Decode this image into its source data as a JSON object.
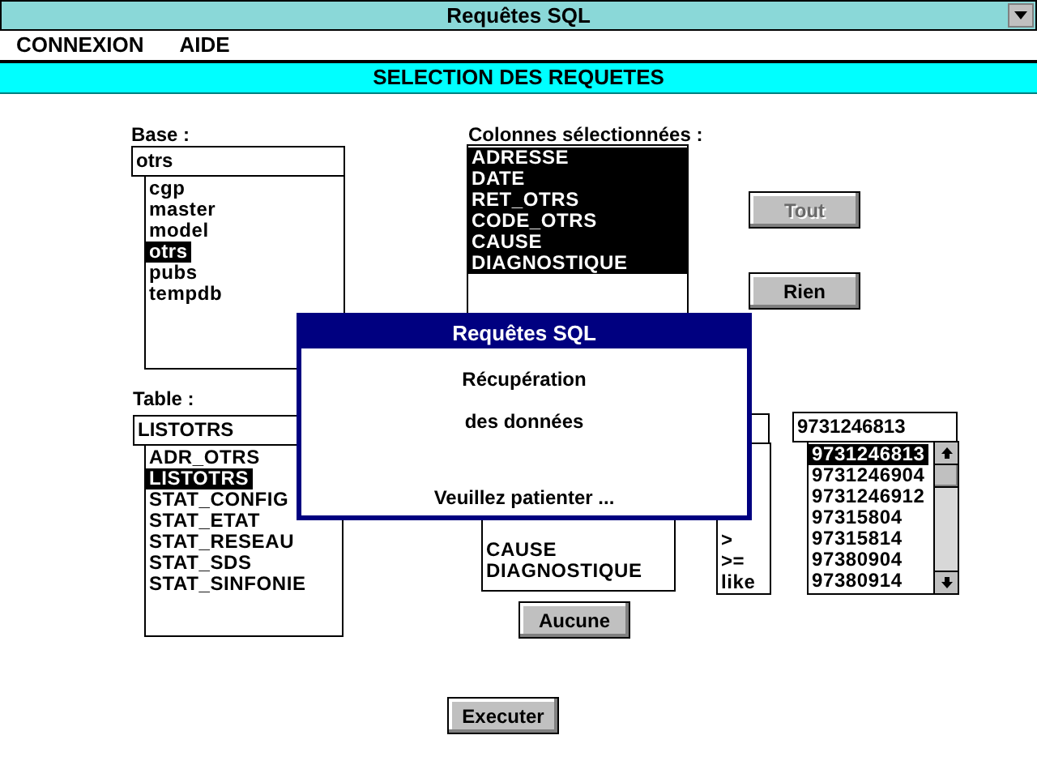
{
  "window": {
    "title": "Requêtes SQL"
  },
  "menu": [
    {
      "label": "CONNEXION"
    },
    {
      "label": "AIDE"
    }
  ],
  "header": "SELECTION DES REQUETES",
  "base": {
    "label": "Base :",
    "value": "otrs",
    "items": [
      {
        "label": "cgp",
        "selected": false
      },
      {
        "label": "master",
        "selected": false
      },
      {
        "label": "model",
        "selected": false
      },
      {
        "label": "otrs",
        "selected": true
      },
      {
        "label": "pubs",
        "selected": false
      },
      {
        "label": "tempdb",
        "selected": false
      }
    ]
  },
  "columns": {
    "label": "Colonnes sélectionnées :",
    "items": [
      {
        "label": "ADRESSE",
        "selected": true
      },
      {
        "label": "DATE",
        "selected": true
      },
      {
        "label": "RET_OTRS",
        "selected": true
      },
      {
        "label": "CODE_OTRS",
        "selected": true
      },
      {
        "label": "CAUSE",
        "selected": true
      },
      {
        "label": "DIAGNOSTIQUE",
        "selected": true
      }
    ]
  },
  "column_buttons": [
    {
      "label": "Tout",
      "disabled": true
    },
    {
      "label": "Rien",
      "disabled": false
    }
  ],
  "table": {
    "label": "Table :",
    "value": "LISTOTRS",
    "items": [
      {
        "label": "ADR_OTRS",
        "selected": false
      },
      {
        "label": "LISTOTRS",
        "selected": true
      },
      {
        "label": "STAT_CONFIG",
        "selected": false
      },
      {
        "label": "STAT_ETAT",
        "selected": false
      },
      {
        "label": "STAT_RESEAU",
        "selected": false
      },
      {
        "label": "STAT_SDS",
        "selected": false
      },
      {
        "label": "STAT_SINFONIE",
        "selected": false
      }
    ]
  },
  "field_list": {
    "items": [
      {
        "label": "CAUSE",
        "selected": false
      },
      {
        "label": "DIAGNOSTIQUE",
        "selected": false
      }
    ],
    "button": {
      "label": "Aucune",
      "disabled": false
    }
  },
  "operators": {
    "items": [
      {
        "label": ">",
        "selected": false
      },
      {
        "label": ">=",
        "selected": false
      },
      {
        "label": "like",
        "selected": false
      }
    ]
  },
  "values": {
    "value": "9731246813",
    "items": [
      {
        "label": "9731246813",
        "selected": true
      },
      {
        "label": "9731246904",
        "selected": false
      },
      {
        "label": "9731246912",
        "selected": false
      },
      {
        "label": "97315804",
        "selected": false
      },
      {
        "label": "97315814",
        "selected": false
      },
      {
        "label": "97380904",
        "selected": false
      },
      {
        "label": "97380914",
        "selected": false
      }
    ]
  },
  "execute_button": {
    "label": "Executer",
    "disabled": false
  },
  "dialog": {
    "title": "Requêtes SQL",
    "lines": [
      "Récupération",
      "des données",
      "Veuillez patienter ..."
    ]
  }
}
